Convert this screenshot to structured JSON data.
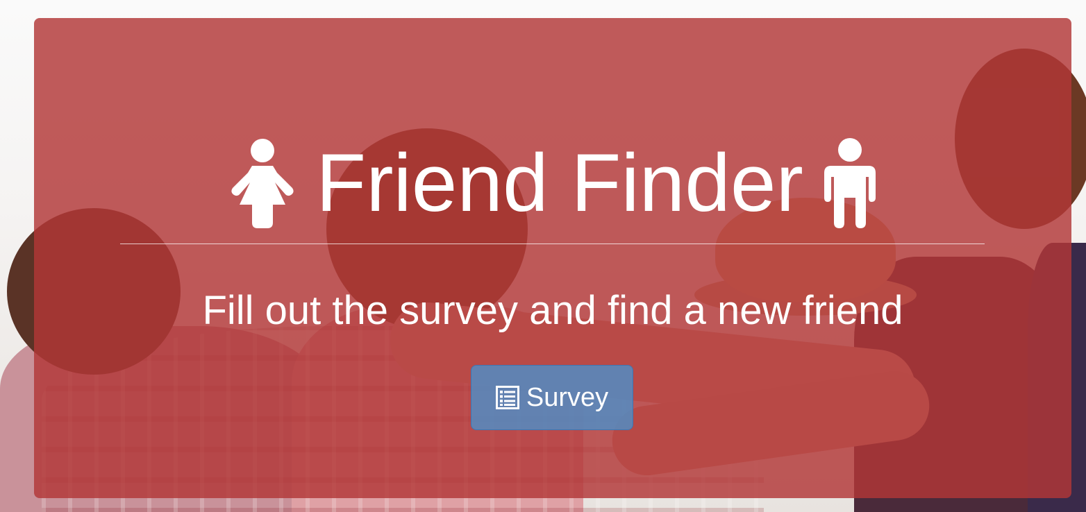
{
  "background": {
    "panel_color": "#b23737",
    "button_color": "#4e8fc8"
  },
  "jumbotron": {
    "title": "Friend Finder",
    "left_icon": "female-icon",
    "right_icon": "male-icon",
    "subtitle": "Fill out the survey and find a new friend",
    "button": {
      "label": "Survey",
      "icon": "list-alt-icon"
    }
  }
}
